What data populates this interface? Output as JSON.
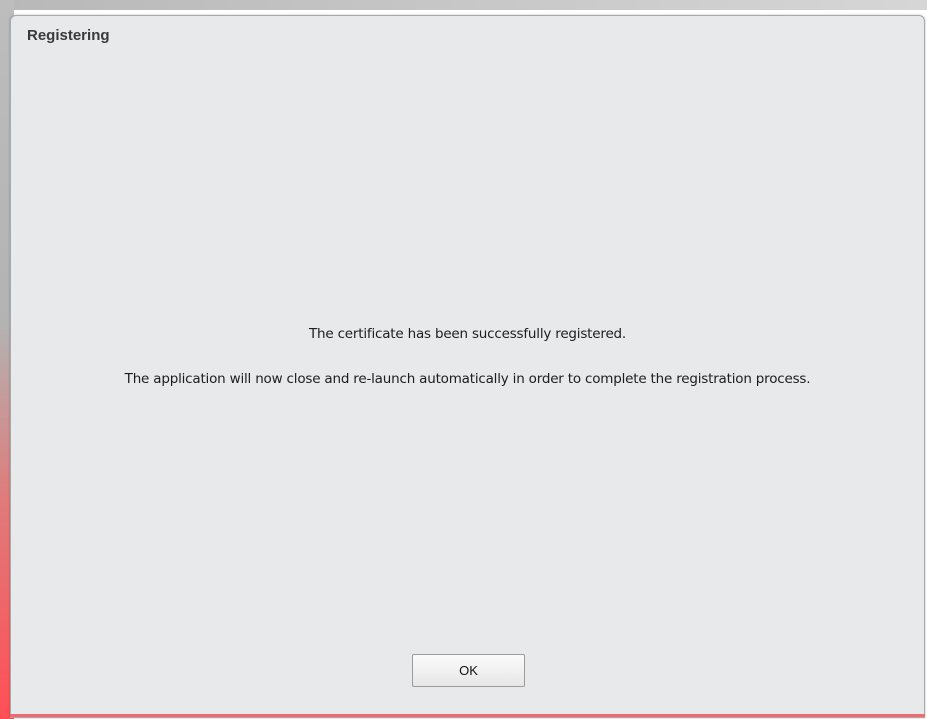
{
  "dialog": {
    "title": "Registering",
    "message_line1": "The certificate has been successfully registered.",
    "message_line2": "The application will now close and re-launch automatically in order to complete the registration process.",
    "ok_label": "OK"
  },
  "colors": {
    "dialog_background": "#e7e9ea",
    "edge_accent": "#f06a6e"
  }
}
